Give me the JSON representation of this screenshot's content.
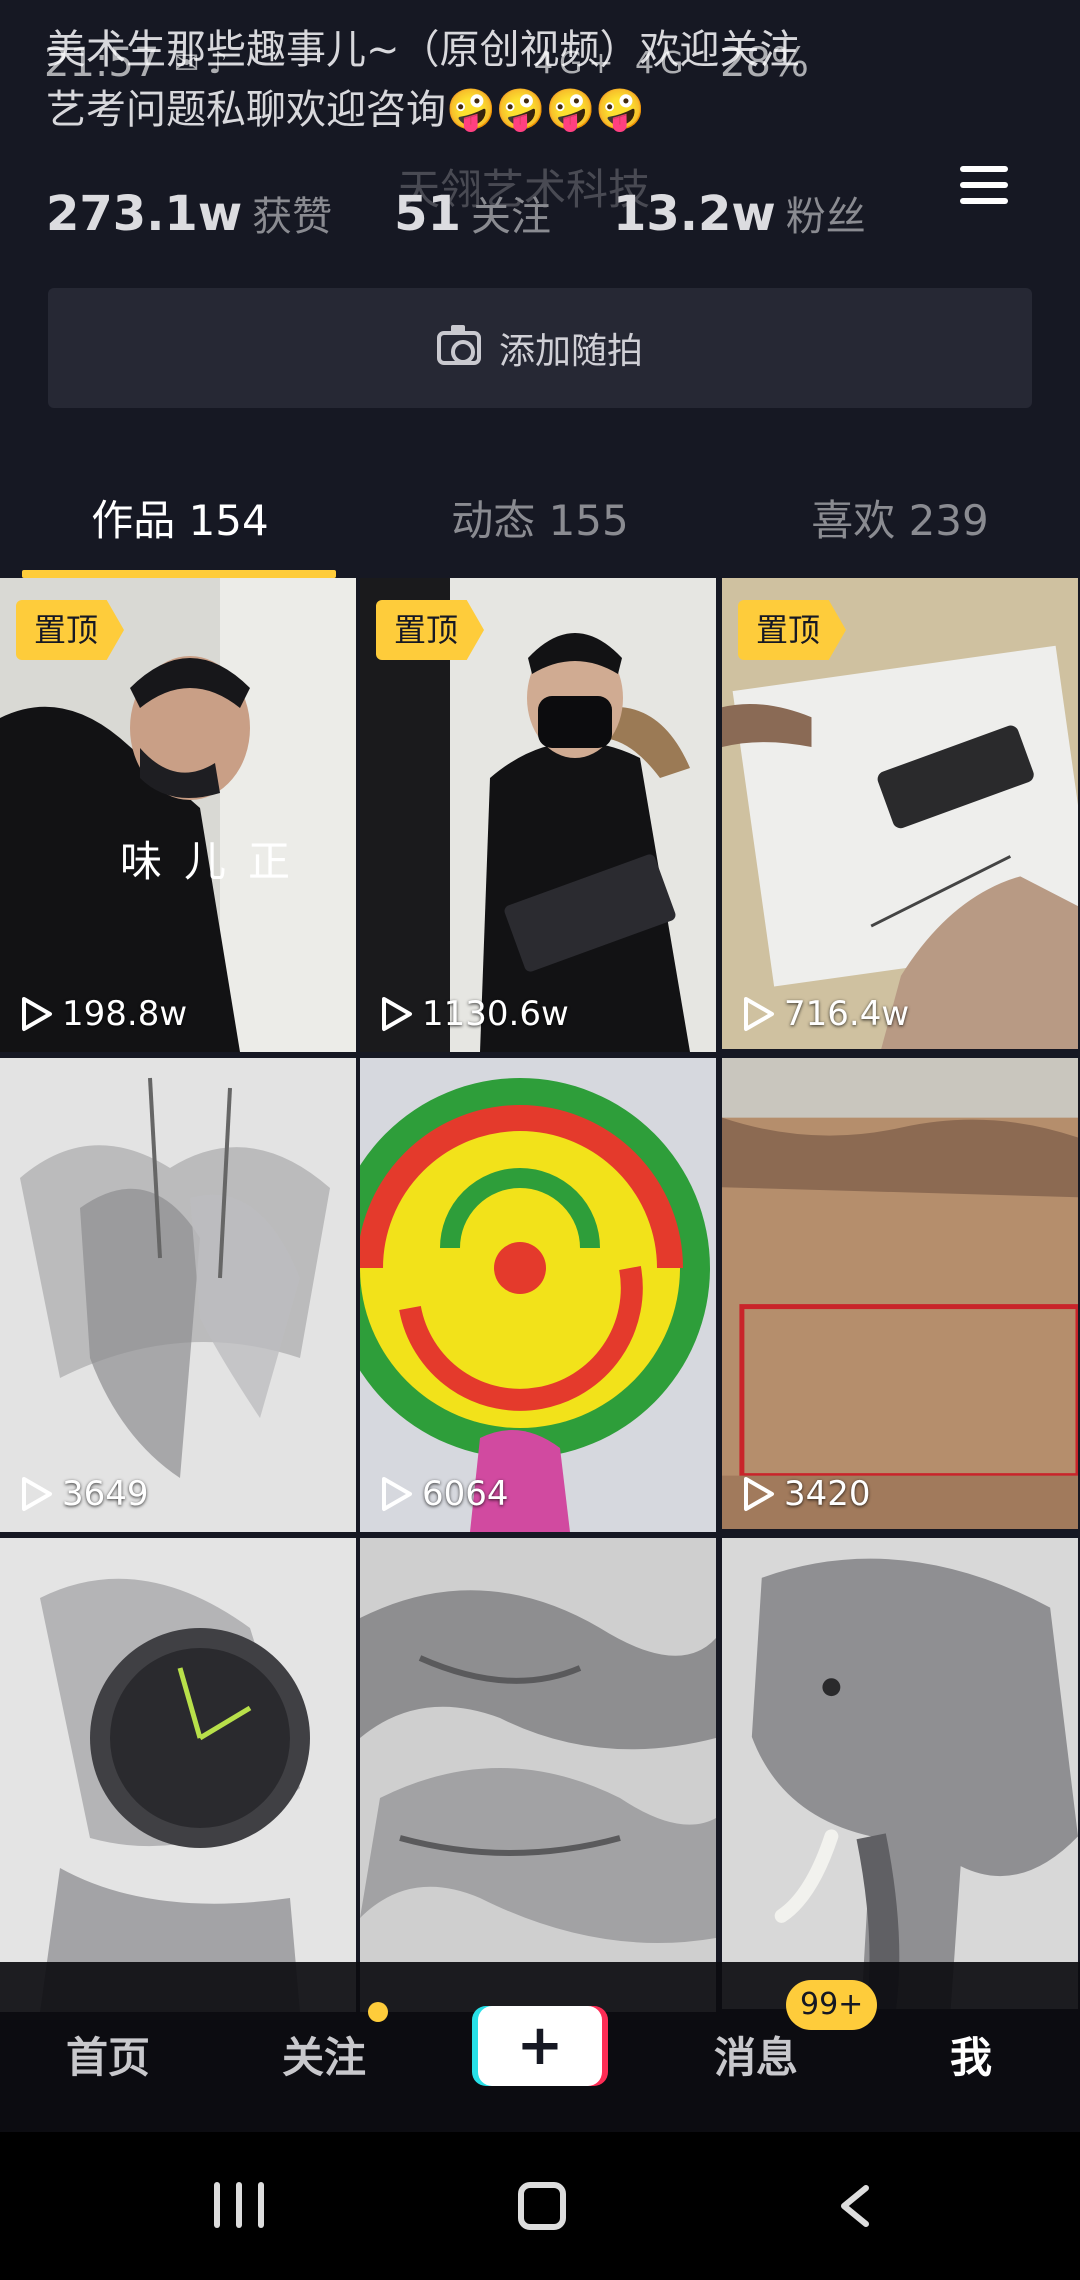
{
  "status_bar": {
    "time": "21:57",
    "left_icons": "✉ ♪",
    "signal": "4G+ 4G",
    "battery": "28%"
  },
  "profile": {
    "bio_line1": "美术生那些趣事儿~（原创视频）欢迎关注",
    "bio_line2": "艺考问题私聊欢迎咨询🤪🤪🤪🤪",
    "watermark": "天翎艺术科技",
    "stats": [
      {
        "num": "273.1w",
        "label": "获赞"
      },
      {
        "num": "51",
        "label": "关注"
      },
      {
        "num": "13.2w",
        "label": "粉丝"
      }
    ],
    "add_button_label": "添加随拍"
  },
  "tabs": [
    {
      "label": "作品 154",
      "active": true
    },
    {
      "label": "动态 155",
      "active": false
    },
    {
      "label": "喜欢 239",
      "active": false
    }
  ],
  "videos": [
    {
      "pinned": true,
      "pin_label": "置顶",
      "plays": "198.8w",
      "caption": "味儿正",
      "thumb": "person-mask"
    },
    {
      "pinned": true,
      "pin_label": "置顶",
      "plays": "1130.6w",
      "caption": "",
      "thumb": "person-case"
    },
    {
      "pinned": true,
      "pin_label": "置顶",
      "plays": "716.4w",
      "caption": "",
      "thumb": "drawing-phone"
    },
    {
      "pinned": false,
      "pin_label": "",
      "plays": "3649",
      "caption": "",
      "thumb": "umbrella-sketch"
    },
    {
      "pinned": false,
      "pin_label": "",
      "plays": "6064",
      "caption": "",
      "thumb": "lollipop"
    },
    {
      "pinned": false,
      "pin_label": "",
      "plays": "3420",
      "caption": "",
      "thumb": "old-book"
    },
    {
      "pinned": false,
      "pin_label": "",
      "plays": "",
      "caption": "",
      "thumb": "watch-sketch"
    },
    {
      "pinned": false,
      "pin_label": "",
      "plays": "",
      "caption": "",
      "thumb": "snake-sketch"
    },
    {
      "pinned": false,
      "pin_label": "",
      "plays": "",
      "caption": "",
      "thumb": "elephant-sketch"
    }
  ],
  "bottom_nav": {
    "home": "首页",
    "following": "关注",
    "create": "+",
    "messages": "消息",
    "messages_badge": "99+",
    "me": "我"
  },
  "colors": {
    "accent": "#fecc3b",
    "background": "#161823",
    "brand_cyan": "#28e0e8",
    "brand_red": "#fe2c55"
  }
}
